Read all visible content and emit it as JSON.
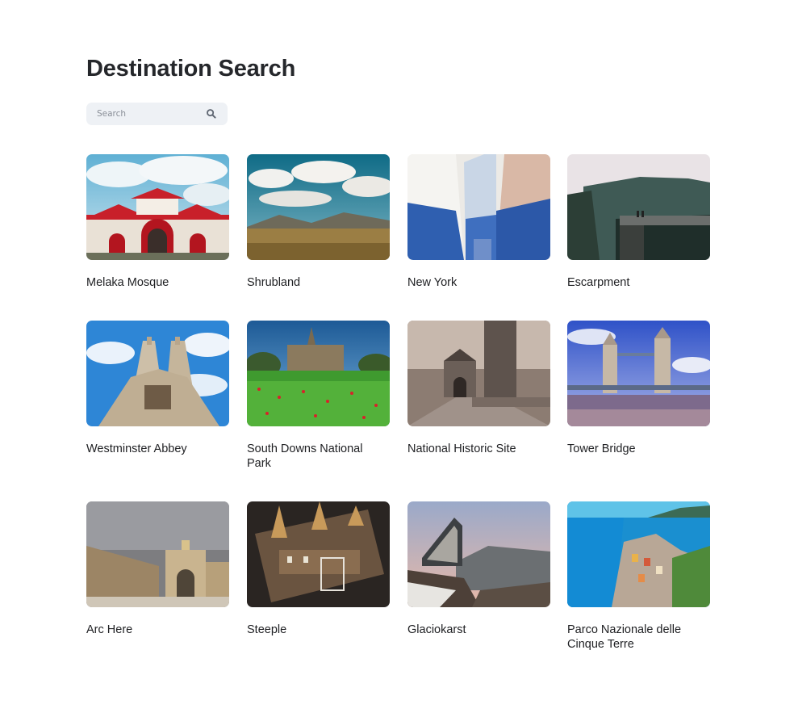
{
  "page": {
    "title": "Destination Search"
  },
  "search": {
    "placeholder": "Search",
    "value": "",
    "icon": "search-icon"
  },
  "destinations": [
    {
      "name": "Melaka Mosque"
    },
    {
      "name": "Shrubland"
    },
    {
      "name": "New York"
    },
    {
      "name": "Escarpment"
    },
    {
      "name": "Westminster Abbey"
    },
    {
      "name": "South Downs National Park"
    },
    {
      "name": "National Historic Site"
    },
    {
      "name": "Tower Bridge"
    },
    {
      "name": "Arc Here"
    },
    {
      "name": "Steeple"
    },
    {
      "name": "Glaciokarst"
    },
    {
      "name": "Parco Nazionale delle Cinque Terre"
    }
  ]
}
